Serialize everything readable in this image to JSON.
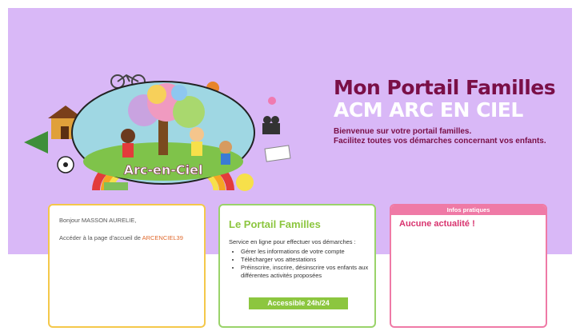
{
  "hero": {
    "title": "Mon Portail Familles",
    "subtitle": "ACM ARC EN CIEL",
    "welcome_line1": "Bienvenue sur votre portail familles.",
    "welcome_line2": "Facilitez toutes vos démarches concernant vos enfants.",
    "logo_text": "Arc-en-Ciel"
  },
  "card_user": {
    "greeting": "Bonjour MASSON AURELIE,",
    "access_text": "Accéder à la page d'accueil de ",
    "access_link": "ARCENCIEL39"
  },
  "card_portal": {
    "title": "Le Portail Familles",
    "intro": "Service en ligne pour effectuer vos démarches :",
    "items": [
      "Gérer les informations de votre compte",
      "Télécharger vos attestations",
      "Préinscrire, inscrire, désinscrire vos enfants aux différentes activités proposées"
    ],
    "badge": "Accessible 24h/24"
  },
  "card_info": {
    "header": "Infos pratiques",
    "message": "Aucune actualité !"
  },
  "colors": {
    "hero_bg": "#d9b8f7",
    "title_color": "#7a0f47",
    "card_yellow": "#f4c84a",
    "card_green": "#9ad36a",
    "card_pink": "#ef7aa6"
  }
}
